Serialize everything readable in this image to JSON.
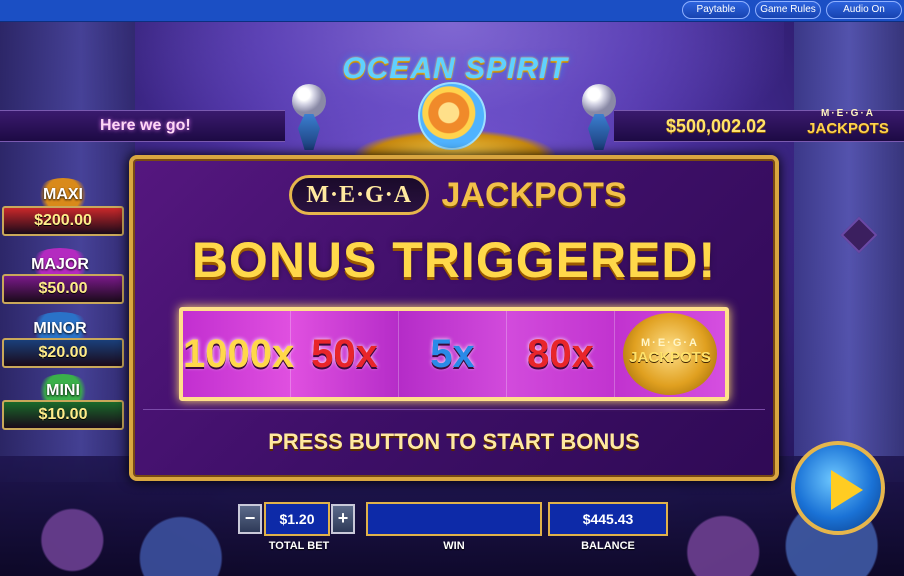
{
  "topbar": {
    "paytable_label": "Paytable",
    "game_rules_label": "Game Rules",
    "audio_label": "Audio On"
  },
  "game": {
    "logo_text": "OCEAN SPIRIT",
    "message": "Here we go!",
    "progressive_amount": "$500,002.02",
    "mega_logo_top": "M·E·G·A",
    "mega_logo_bottom": "JACKPOTS"
  },
  "jackpots": [
    {
      "name": "MAXI",
      "value": "$200.00",
      "color": "#c9282a",
      "title_color": "#d98a1a"
    },
    {
      "name": "MAJOR",
      "value": "$50.00",
      "color": "#7a1a8a",
      "title_color": "#b42ac0"
    },
    {
      "name": "MINOR",
      "value": "$20.00",
      "color": "#1a3f7a",
      "title_color": "#2a72c8"
    },
    {
      "name": "MINI",
      "value": "$10.00",
      "color": "#1a6a2a",
      "title_color": "#3ab04a"
    }
  ],
  "bonus_panel": {
    "mega_pill": "M·E·G·A",
    "mega_word": "JACKPOTS",
    "title": "BONUS TRIGGERED!",
    "multipliers": [
      {
        "label": "1000x",
        "color": "#ffd84a"
      },
      {
        "label": "50x",
        "color": "#e8252a"
      },
      {
        "label": "5x",
        "color": "#2a8ae8"
      },
      {
        "label": "80x",
        "color": "#e8252a"
      }
    ],
    "coin_top": "M·E·G·A",
    "coin_bottom": "JACKPOTS",
    "press_text": "PRESS BUTTON TO START BONUS"
  },
  "bottom": {
    "minus_label": "−",
    "plus_label": "+",
    "total_bet_value": "$1.20",
    "total_bet_label": "TOTAL BET",
    "win_value": "",
    "win_label": "WIN",
    "balance_value": "$445.43",
    "balance_label": "BALANCE"
  }
}
